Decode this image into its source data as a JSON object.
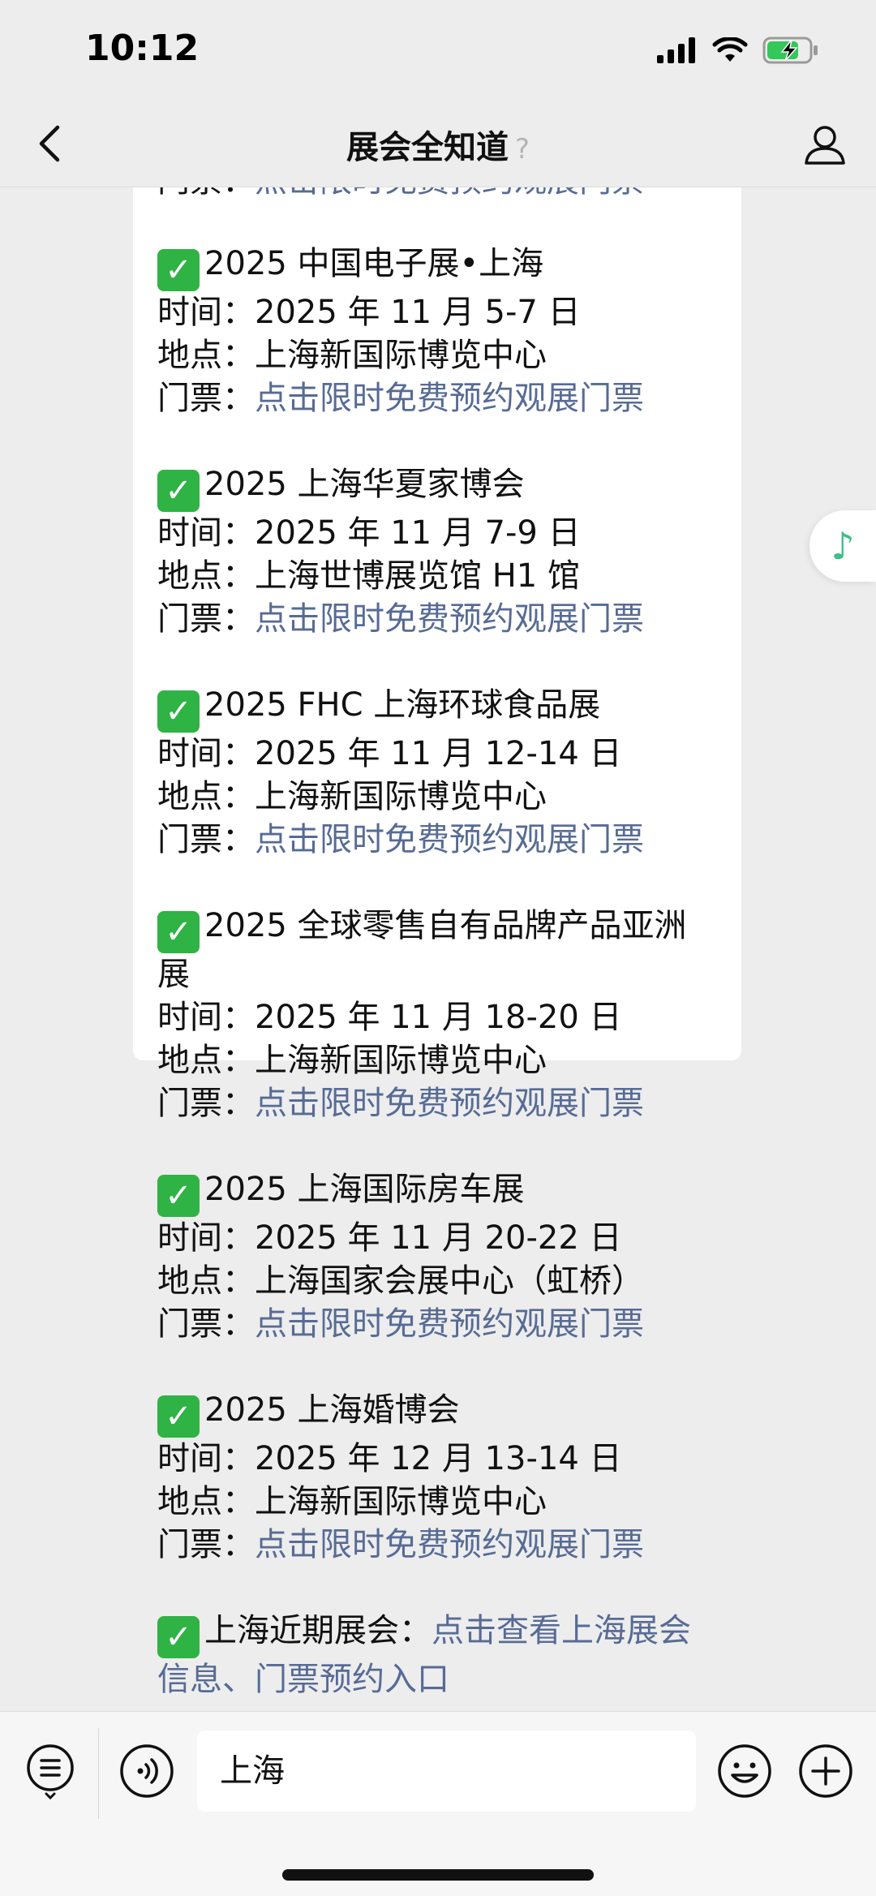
{
  "status_bar": {
    "time": "10:12"
  },
  "nav": {
    "title": "展会全知道",
    "ear_glyph": "?"
  },
  "message": {
    "partial_top_line": {
      "label": "门票：",
      "link": "点击限时免费预约观展门票"
    },
    "events": [
      {
        "title": "2025 中国电子展•上海",
        "time_label": "时间：",
        "time": "2025 年 11 月 5-7 日",
        "place_label": "地点：",
        "place": "上海新国际博览中心",
        "ticket_label": "门票：",
        "ticket_link": "点击限时免费预约观展门票"
      },
      {
        "title": "2025 上海华夏家博会",
        "time_label": "时间：",
        "time": "2025 年 11 月 7-9 日",
        "place_label": "地点：",
        "place": "上海世博展览馆 H1 馆",
        "ticket_label": "门票：",
        "ticket_link": "点击限时免费预约观展门票"
      },
      {
        "title": "2025 FHC 上海环球食品展",
        "time_label": "时间：",
        "time": "2025 年 11 月 12-14 日",
        "place_label": "地点：",
        "place": "上海新国际博览中心",
        "ticket_label": "门票：",
        "ticket_link": "点击限时免费预约观展门票"
      },
      {
        "title": "2025 全球零售自有品牌产品亚洲展",
        "time_label": "时间：",
        "time": "2025 年 11 月 18-20 日",
        "place_label": "地点：",
        "place": "上海新国际博览中心",
        "ticket_label": "门票：",
        "ticket_link": "点击限时免费预约观展门票"
      },
      {
        "title": "2025 上海国际房车展",
        "time_label": "时间：",
        "time": "2025 年 11 月 20-22 日",
        "place_label": "地点：",
        "place": "上海国家会展中心（虹桥）",
        "ticket_label": "门票：",
        "ticket_link": "点击限时免费预约观展门票"
      },
      {
        "title": "2025 上海婚博会",
        "time_label": "时间：",
        "time": "2025 年 12 月 13-14 日",
        "place_label": "地点：",
        "place": "上海新国际博览中心",
        "ticket_label": "门票：",
        "ticket_link": "点击限时免费预约观展门票"
      }
    ],
    "footer": {
      "label": "上海近期展会：",
      "link": "点击查看上海展会信息、门票预约入口"
    },
    "check_glyph": "✓"
  },
  "music_glyph": "♪",
  "input_bar": {
    "value": "上海"
  },
  "colors": {
    "background": "#ededed",
    "bubble": "#ffffff",
    "link": "#576b95",
    "check": "#2fb344",
    "music": "#3fbf8a",
    "battery": "#34c759"
  },
  "icons": {
    "back": "chevron-left-icon",
    "profile": "person-icon",
    "menu": "list-menu-icon",
    "voice": "voice-icon",
    "emoji": "emoji-icon",
    "add": "plus-icon",
    "music": "music-note-icon"
  }
}
